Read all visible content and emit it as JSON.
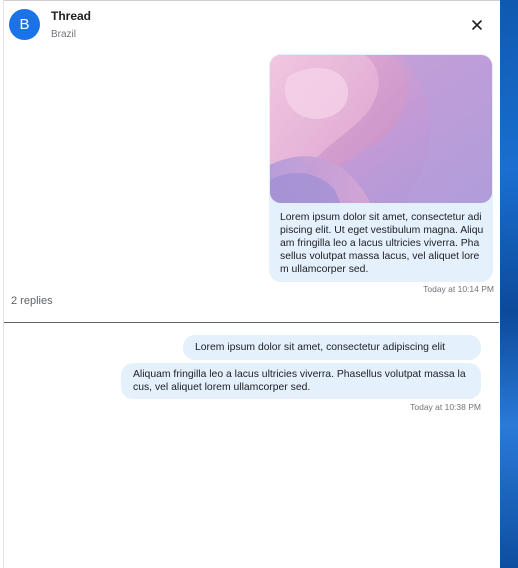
{
  "header": {
    "avatar_letter": "B",
    "title": "Thread",
    "subtitle": "Brazil"
  },
  "original_message": {
    "image": "abstract-pink-purple-wallpaper",
    "text": "Lorem ipsum dolor sit amet, consectetur adipiscing elit. Ut eget vestibulum magna. Aliquam fringilla leo a lacus ultricies viverra. Phasellus volutpat massa lacus, vel aliquet lorem ullamcorper sed.",
    "timestamp": "Today at 10:14 PM"
  },
  "replies_count": "2 replies",
  "replies": [
    {
      "text": "Lorem ipsum dolor sit amet, consectetur adipiscing elit"
    },
    {
      "text": "Aliquam fringilla leo a lacus ultricies viverra. Phasellus volutpat massa lacus, vel aliquet lorem ullamcorper sed."
    }
  ],
  "replies_timestamp": "Today at 10:38 PM",
  "colors": {
    "avatar": "#1a73e8",
    "bubble": "#e5f0fd",
    "wallpaper": "#1a6fd0"
  },
  "icons": {
    "close": "close-icon"
  }
}
